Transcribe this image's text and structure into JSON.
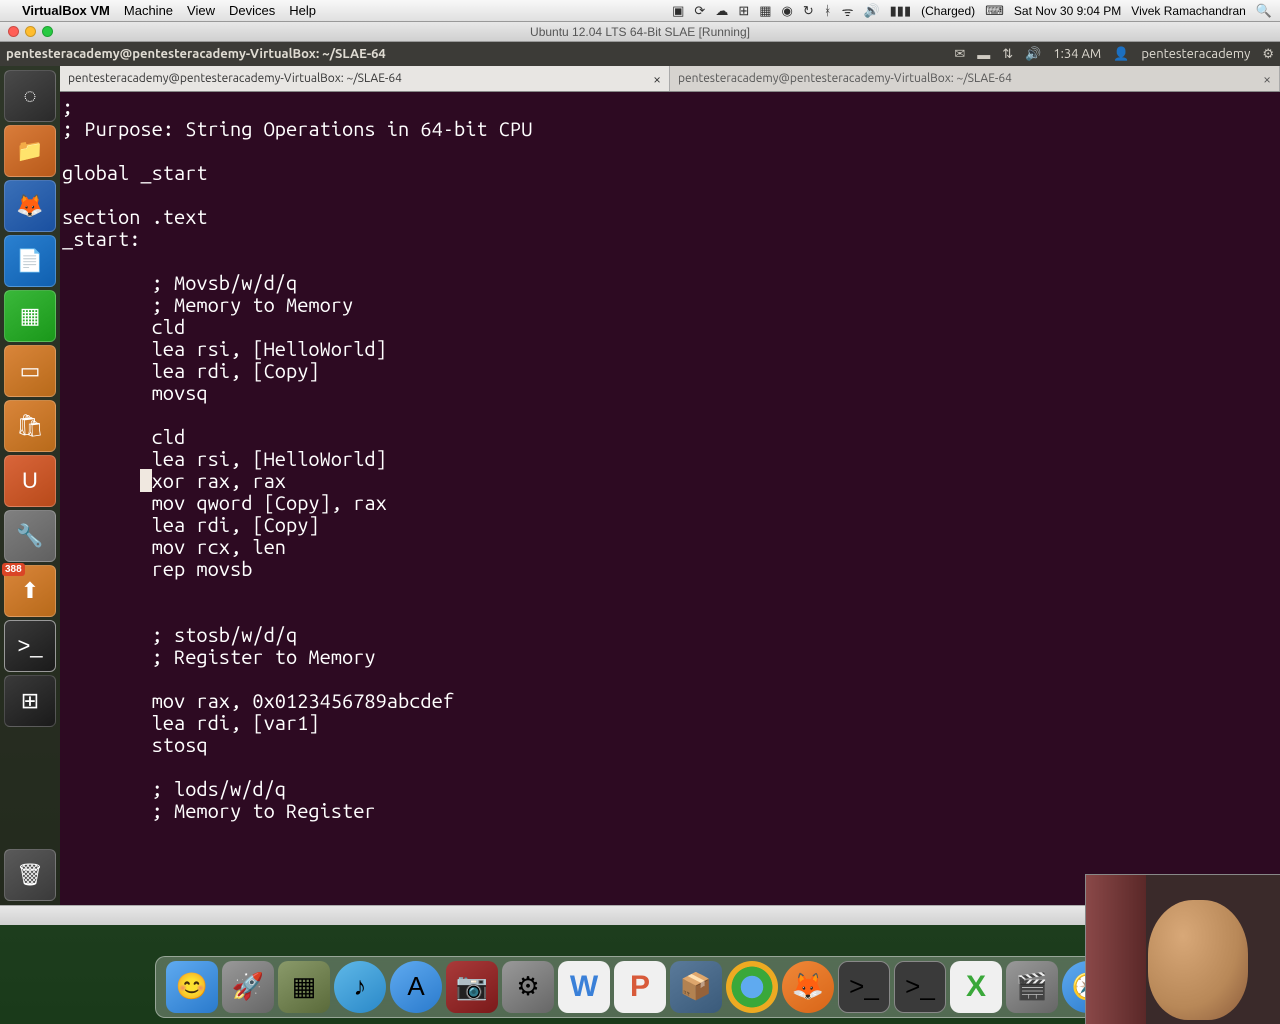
{
  "mac_menu": {
    "app": "VirtualBox VM",
    "items": [
      "Machine",
      "View",
      "Devices",
      "Help"
    ],
    "battery": "(Charged)",
    "clock": "Sat Nov 30  9:04 PM",
    "user": "Vivek Ramachandran"
  },
  "vm_title": "Ubuntu 12.04 LTS 64-Bit SLAE [Running]",
  "ubuntu_panel": {
    "title": "pentesteracademy@pentesteracademy-VirtualBox: ~/SLAE-64",
    "clock": "1:34 AM",
    "user": "pentesteracademy"
  },
  "launcher_badge": "388",
  "tabs": {
    "tab1": "pentesteracademy@pentesteracademy-VirtualBox: ~/SLAE-64",
    "tab2": "pentesteracademy@pentesteracademy-VirtualBox: ~/SLAE-64"
  },
  "code_lines": [
    ";",
    "; Purpose: String Operations in 64-bit CPU",
    "",
    "global _start",
    "",
    "section .text",
    "_start:",
    "",
    "        ; Movsb/w/d/q",
    "        ; Memory to Memory",
    "        cld",
    "        lea rsi, [HelloWorld]",
    "        lea rdi, [Copy]",
    "        movsq",
    "",
    "        cld",
    "        lea rsi, [HelloWorld]",
    "        xor rax, rax",
    "        mov qword [Copy], rax",
    "        lea rdi, [Copy]",
    "        mov rcx, len",
    "        rep movsb",
    "",
    "",
    "        ; stosb/w/d/q",
    "        ; Register to Memory",
    "",
    "        mov rax, 0x0123456789abcdef",
    "        lea rdi, [var1]",
    "        stosq",
    "",
    "        ; lods/w/d/q",
    "        ; Memory to Register",
    ""
  ],
  "cursor_line": 17,
  "status_pos": "23"
}
